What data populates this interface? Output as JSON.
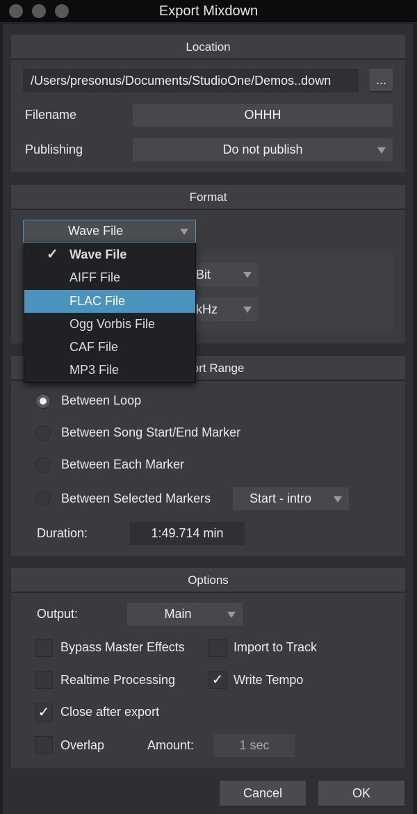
{
  "window": {
    "title": "Export Mixdown"
  },
  "location": {
    "header": "Location",
    "path": "/Users/presonus/Documents/StudioOne/Demos..down",
    "browse_label": "...",
    "filename_label": "Filename",
    "filename_value": "OHHH",
    "publishing_label": "Publishing",
    "publishing_value": "Do not publish"
  },
  "format": {
    "header": "Format",
    "selected": "Wave File",
    "bit_value": "Bit",
    "rate_value": "kHz",
    "menu_items": [
      {
        "label": "Wave File",
        "checked": true
      },
      {
        "label": "AIFF File"
      },
      {
        "label": "FLAC File",
        "highlighted": true
      },
      {
        "label": "Ogg Vorbis File"
      },
      {
        "label": "CAF File"
      },
      {
        "label": "MP3 File"
      }
    ]
  },
  "export_range": {
    "header": "Export Range",
    "options": [
      {
        "label": "Between Loop",
        "selected": true
      },
      {
        "label": "Between Song Start/End Marker"
      },
      {
        "label": "Between Each Marker"
      },
      {
        "label": "Between Selected Markers"
      }
    ],
    "markers_value": "Start - intro",
    "duration_label": "Duration:",
    "duration_value": "1:49.714 min"
  },
  "options": {
    "header": "Options",
    "output_label": "Output:",
    "output_value": "Main",
    "checkboxes": [
      {
        "label": "Bypass Master Effects",
        "checked": false
      },
      {
        "label": "Import to Track",
        "checked": false
      },
      {
        "label": "Realtime Processing",
        "checked": false
      },
      {
        "label": "Write Tempo",
        "checked": true
      },
      {
        "label": "Close after export",
        "checked": true
      },
      {
        "label": "Overlap",
        "checked": false
      }
    ],
    "amount_label": "Amount:",
    "amount_value": "1 sec"
  },
  "buttons": {
    "cancel": "Cancel",
    "ok": "OK"
  },
  "colors": {
    "accent": "#4a93bd"
  }
}
